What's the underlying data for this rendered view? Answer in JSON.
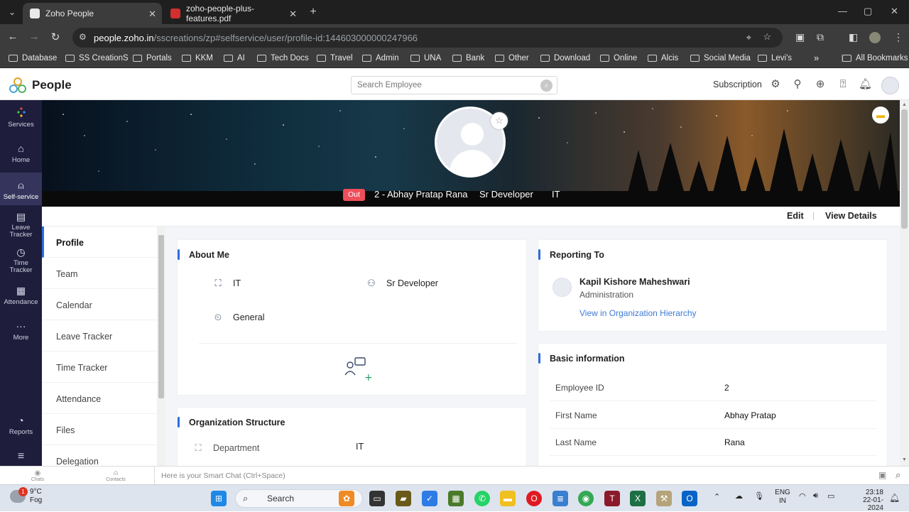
{
  "browser": {
    "tabs": [
      {
        "label": "Zoho People",
        "active": true
      },
      {
        "label": "zoho-people-plus-features.pdf",
        "active": false
      }
    ],
    "url_host": "people.zoho.in",
    "url_path": "/sscreations/zp#selfservice/user/profile-id:144603000000247966",
    "bookmarks": [
      "Database",
      "SS CreationS",
      "Portals",
      "KKM",
      "AI",
      "Tech Docs",
      "Travel",
      "Admin",
      "UNA",
      "Bank",
      "Other",
      "Download",
      "Online",
      "Alcis",
      "Social Media",
      "Levi's"
    ],
    "all_bookmarks": "All Bookmarks",
    "more_bookmarks": "»"
  },
  "app": {
    "name": "People",
    "search_placeholder": "Search Employee",
    "subscription": "Subscription"
  },
  "leftnav": {
    "items": [
      {
        "label": "Services",
        "icon": "services-icon"
      },
      {
        "label": "Home",
        "icon": "home-icon"
      },
      {
        "label": "Self-service",
        "icon": "person-icon",
        "active": true
      },
      {
        "label": "Leave Tracker",
        "icon": "leave-icon"
      },
      {
        "label": "Time Tracker",
        "icon": "clock-icon"
      },
      {
        "label": "Attendance",
        "icon": "attendance-icon"
      },
      {
        "label": "More",
        "icon": "more-icon"
      },
      {
        "label": "Reports",
        "icon": "reports-icon"
      }
    ]
  },
  "profile": {
    "status": "Out",
    "name": "2 - Abhay Pratap Rana",
    "designation": "Sr Developer",
    "department": "IT",
    "edit": "Edit",
    "view_details": "View Details"
  },
  "subnav": {
    "items": [
      "Profile",
      "Team",
      "Calendar",
      "Leave Tracker",
      "Time Tracker",
      "Attendance",
      "Files",
      "Delegation"
    ],
    "active": "Profile"
  },
  "about_me": {
    "title": "About Me",
    "department": "IT",
    "designation": "Sr Developer",
    "shift": "General"
  },
  "org_structure": {
    "title": "Organization Structure",
    "rows": [
      {
        "key": "Department",
        "value": "IT"
      }
    ]
  },
  "reporting_to": {
    "title": "Reporting To",
    "name": "Kapil Kishore Maheshwari",
    "department": "Administration",
    "link": "View in Organization Hierarchy"
  },
  "basic_info": {
    "title": "Basic information",
    "rows": [
      {
        "key": "Employee ID",
        "value": "2"
      },
      {
        "key": "First Name",
        "value": "Abhay Pratap"
      },
      {
        "key": "Last Name",
        "value": "Rana"
      }
    ]
  },
  "smartchat": {
    "placeholder": "Here is your Smart Chat (Ctrl+Space)",
    "chats": "Chats",
    "contacts": "Contacts"
  },
  "taskbar": {
    "weather_temp": "9°C",
    "weather_desc": "Fog",
    "weather_badge": "1",
    "search": "Search",
    "lang_top": "ENG",
    "lang_bottom": "IN",
    "time": "23:18",
    "date": "22-01-2024"
  },
  "colors": {
    "accent": "#2d6cdf",
    "nav_bg": "#1e1e3c",
    "status_out": "#ef4e5a",
    "link": "#3e7bd6"
  }
}
